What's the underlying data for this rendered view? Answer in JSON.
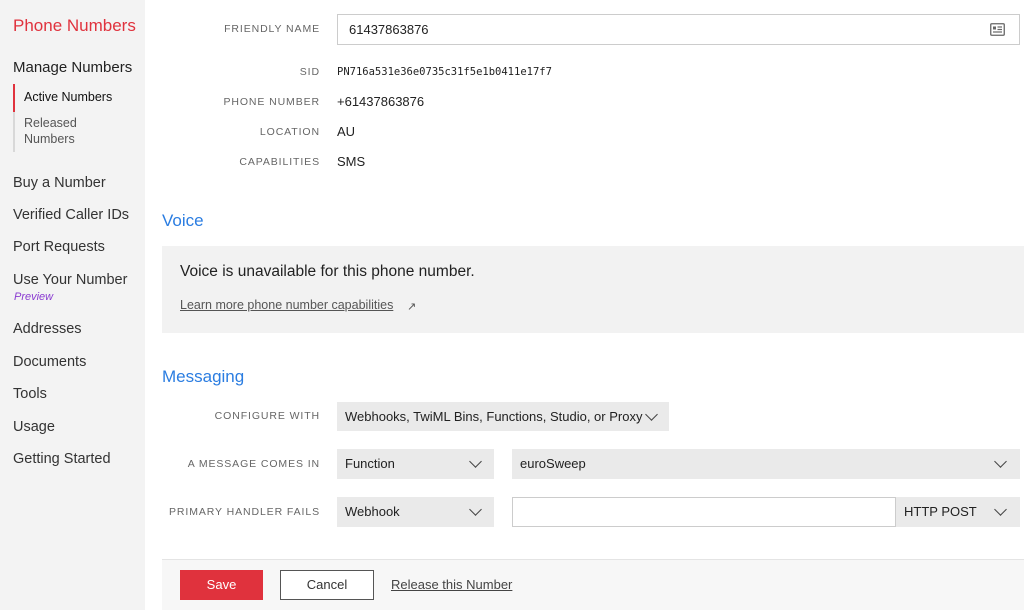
{
  "sidebar": {
    "title": "Phone Numbers",
    "manage": "Manage Numbers",
    "sub_items": [
      "Active Numbers",
      "Released Numbers"
    ],
    "items": [
      "Buy a Number",
      "Verified Caller IDs",
      "Port Requests",
      "Use Your Number",
      "Addresses",
      "Documents",
      "Tools",
      "Usage",
      "Getting Started"
    ],
    "preview_badge": "Preview",
    "accent_color": "#e0323d"
  },
  "properties": {
    "friendly_name_label": "FRIENDLY NAME",
    "friendly_name_value": "61437863876",
    "friendly_name_icon": "contact-card-icon",
    "sid_label": "SID",
    "sid_value": "PN716a531e36e0735c31f5e1b0411e17f7",
    "phone_label": "PHONE NUMBER",
    "phone_value": "+61437863876",
    "location_label": "LOCATION",
    "location_value": "AU",
    "capabilities_label": "CAPABILITIES",
    "capabilities_value": "SMS"
  },
  "voice": {
    "title": "Voice",
    "message": "Voice is unavailable for this phone number.",
    "link": "Learn more phone number capabilities",
    "link_icon": "external-link-icon"
  },
  "messaging": {
    "title": "Messaging",
    "configure_label": "CONFIGURE WITH",
    "configure_value": "Webhooks, TwiML Bins, Functions, Studio, or Proxy",
    "comes_in_label": "A MESSAGE COMES IN",
    "comes_in_type": "Function",
    "comes_in_target": "euroSweep",
    "fails_label": "PRIMARY HANDLER FAILS",
    "fails_type": "Webhook",
    "fails_url": "",
    "fails_method": "HTTP POST"
  },
  "footer": {
    "save": "Save",
    "cancel": "Cancel",
    "release": "Release this Number"
  },
  "colors": {
    "brand_red": "#e0323d",
    "section_blue": "#2b7de1",
    "preview_purple": "#8a3bd1"
  }
}
